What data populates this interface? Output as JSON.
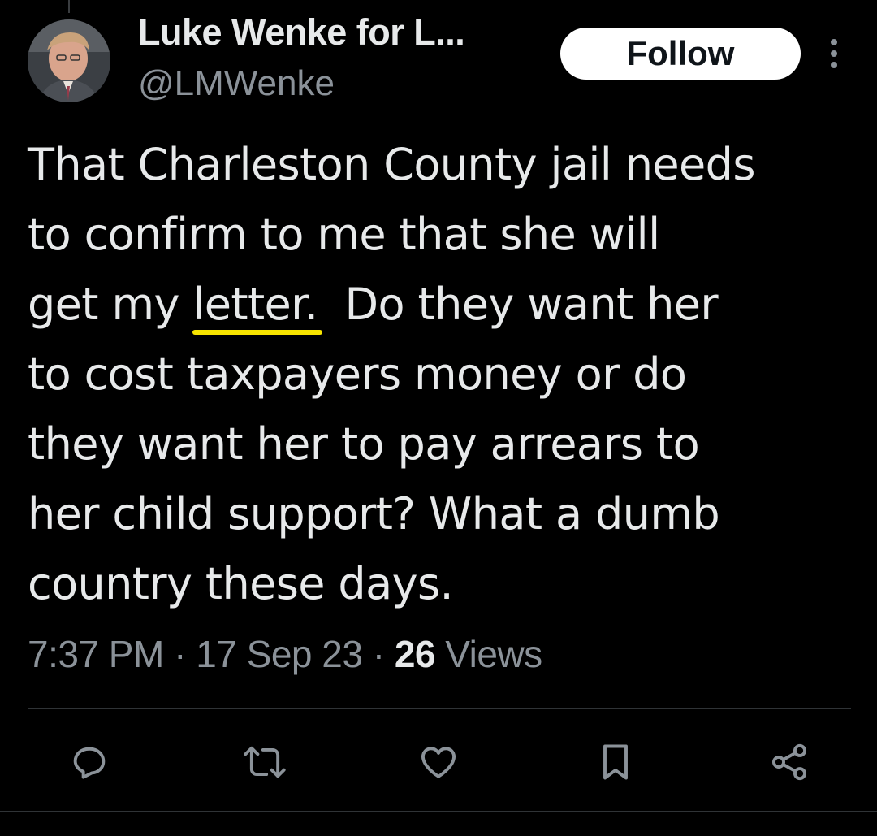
{
  "author": {
    "name": "Luke Wenke for L...",
    "handle": "@LMWenke"
  },
  "header": {
    "follow_label": "Follow",
    "more_icon": "more-vertical-icon"
  },
  "tweet": {
    "lines": [
      "That Charleston County jail needs",
      "to confirm to me that she will",
      "Do they want her",
      "to cost taxpayers money or do",
      "they want her to pay arrears to",
      "her child support?  What a dumb",
      "country these days."
    ],
    "line3_prefix": "get my ",
    "highlighted_word": "letter.",
    "highlight_color": "#f7e400"
  },
  "meta": {
    "time": "7:37 PM",
    "date": "17 Sep 23",
    "separator": "·",
    "views_count": "26",
    "views_label": "Views"
  },
  "actions": [
    {
      "icon": "reply-icon"
    },
    {
      "icon": "retweet-icon"
    },
    {
      "icon": "like-icon"
    },
    {
      "icon": "bookmark-icon"
    },
    {
      "icon": "share-icon"
    }
  ],
  "colors": {
    "background": "#000000",
    "text": "#e7e9ea",
    "secondary_text": "#8b9299",
    "follow_bg": "#ffffff"
  }
}
